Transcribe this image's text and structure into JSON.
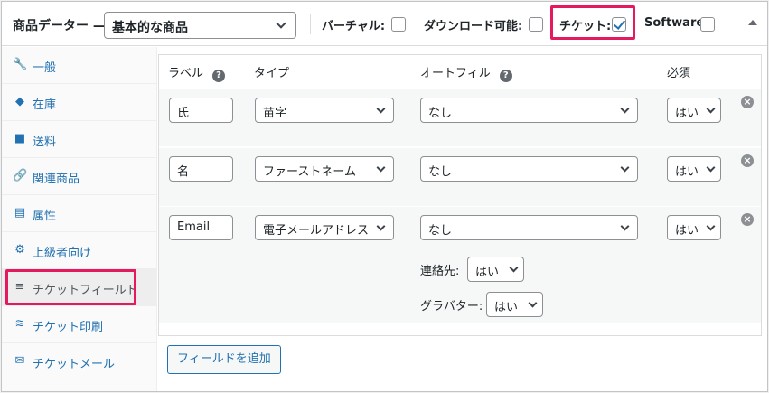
{
  "header": {
    "title": "商品データー —",
    "product_type": "基本的な商品",
    "options": [
      {
        "label": "バーチャル:",
        "checked": false
      },
      {
        "label": "ダウンロード可能:",
        "checked": false
      },
      {
        "label": "チケット:",
        "checked": true
      },
      {
        "label": "Software:",
        "checked": false
      }
    ],
    "accent_color": "#e5195d",
    "link_color": "#2271b1"
  },
  "sidebar": {
    "items": [
      {
        "label": "一般",
        "icon": "wrench-icon",
        "glyph": "🔧"
      },
      {
        "label": "在庫",
        "icon": "tag-icon",
        "glyph": "◆"
      },
      {
        "label": "送料",
        "icon": "truck-icon",
        "glyph": "■"
      },
      {
        "label": "関連商品",
        "icon": "link-icon",
        "glyph": "🔗"
      },
      {
        "label": "属性",
        "icon": "table-icon",
        "glyph": "▤"
      },
      {
        "label": "上級者向け",
        "icon": "gear-icon",
        "glyph": "⚙"
      },
      {
        "label": "チケットフィールド",
        "icon": "menu-icon",
        "glyph": "≡",
        "active": true
      },
      {
        "label": "チケット印刷",
        "icon": "print-icon",
        "glyph": "≋"
      },
      {
        "label": "チケットメール",
        "icon": "mail-icon",
        "glyph": "✉"
      }
    ]
  },
  "table": {
    "columns": {
      "label": "ラベル",
      "type": "タイプ",
      "autofill": "オートフィル",
      "required": "必須"
    },
    "help_glyph": "?",
    "rows": [
      {
        "label": "氏",
        "type": "苗字",
        "autofill": "なし",
        "required": "はい"
      },
      {
        "label": "名",
        "type": "ファーストネーム",
        "autofill": "なし",
        "required": "はい"
      },
      {
        "label": "Email",
        "type": "電子メールアドレス",
        "autofill": "なし",
        "required": "はい",
        "extra": [
          {
            "label": "連絡先:",
            "value": "はい"
          },
          {
            "label": "グラバター:",
            "value": "はい"
          }
        ]
      }
    ],
    "remove_glyph": "×",
    "add_button": "フィールドを追加"
  }
}
